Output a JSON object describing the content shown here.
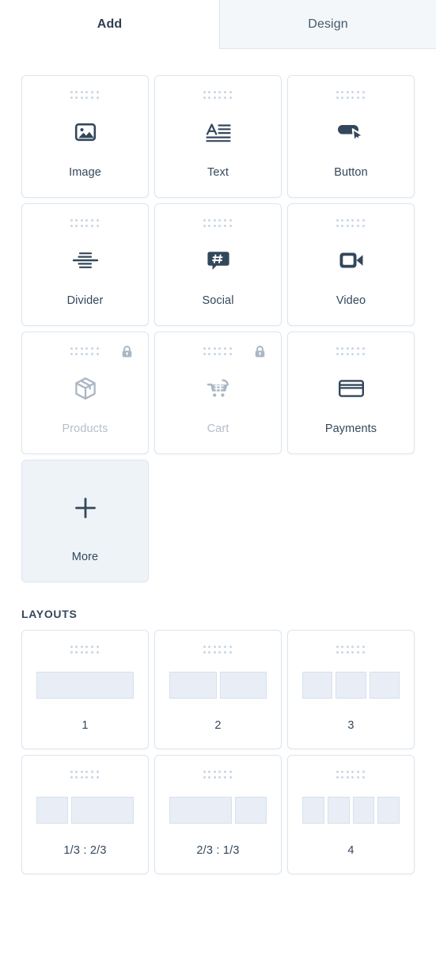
{
  "tabs": [
    {
      "label": "Add",
      "active": true
    },
    {
      "label": "Design",
      "active": false
    }
  ],
  "modules": [
    {
      "label": "Image",
      "icon": "image-icon",
      "locked": false,
      "filled": false
    },
    {
      "label": "Text",
      "icon": "text-icon",
      "locked": false,
      "filled": false
    },
    {
      "label": "Button",
      "icon": "button-icon",
      "locked": false,
      "filled": false
    },
    {
      "label": "Divider",
      "icon": "divider-icon",
      "locked": false,
      "filled": false
    },
    {
      "label": "Social",
      "icon": "social-icon",
      "locked": false,
      "filled": false
    },
    {
      "label": "Video",
      "icon": "video-icon",
      "locked": false,
      "filled": false
    },
    {
      "label": "Products",
      "icon": "products-icon",
      "locked": true,
      "filled": false
    },
    {
      "label": "Cart",
      "icon": "cart-icon",
      "locked": true,
      "filled": false
    },
    {
      "label": "Payments",
      "icon": "payments-icon",
      "locked": false,
      "filled": false
    },
    {
      "label": "More",
      "icon": "plus-icon",
      "locked": false,
      "filled": true
    }
  ],
  "layouts_section": {
    "title": "LAYOUTS",
    "items": [
      {
        "label": "1",
        "columns": [
          1
        ]
      },
      {
        "label": "2",
        "columns": [
          1,
          1
        ]
      },
      {
        "label": "3",
        "columns": [
          1,
          1,
          1
        ]
      },
      {
        "label": "1/3 : 2/3",
        "columns": [
          1,
          2
        ]
      },
      {
        "label": "2/3 : 1/3",
        "columns": [
          2,
          1
        ]
      },
      {
        "label": "4",
        "columns": [
          1,
          1,
          1,
          1
        ]
      }
    ]
  },
  "colors": {
    "icon_dark": "#33475b",
    "icon_muted": "#aab7c4",
    "card_border": "#dce5ee",
    "dot": "#c9d6e5",
    "preview_block": "#e9eef6",
    "tab_inactive_bg": "#f4f7fa",
    "filled_card_bg": "#eef3f8"
  }
}
